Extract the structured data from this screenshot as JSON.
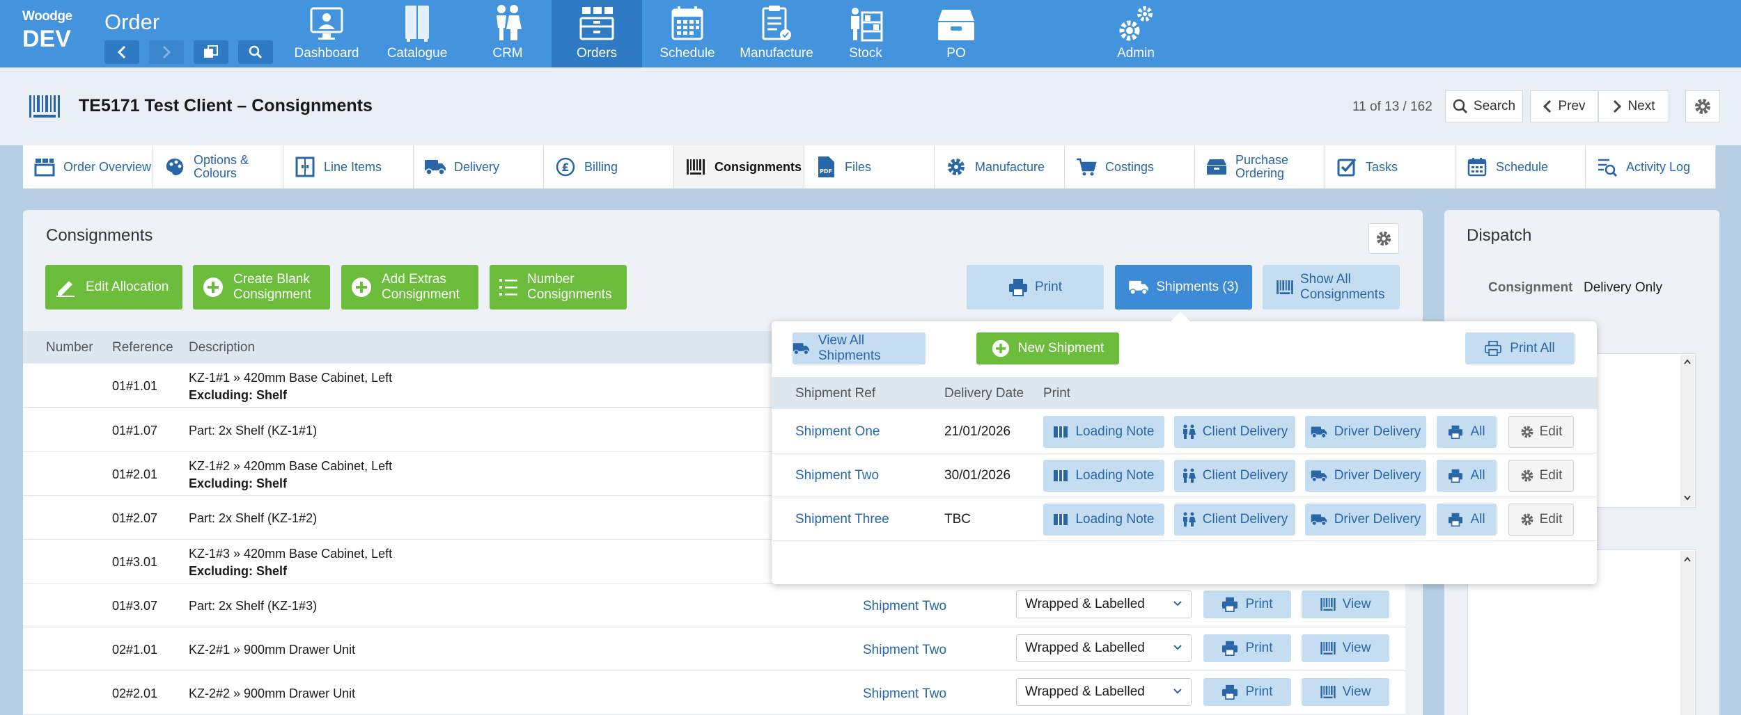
{
  "app": {
    "brand": "Woodge",
    "env": "DEV",
    "module_title": "Order"
  },
  "main_nav": [
    {
      "label": "Dashboard",
      "icon": "dashboard-icon"
    },
    {
      "label": "Catalogue",
      "icon": "catalogue-icon"
    },
    {
      "label": "CRM",
      "icon": "crm-icon"
    },
    {
      "label": "Orders",
      "icon": "orders-icon",
      "active": true
    },
    {
      "label": "Schedule",
      "icon": "schedule-icon"
    },
    {
      "label": "Manufacture",
      "icon": "manufacture-icon"
    },
    {
      "label": "Stock",
      "icon": "stock-icon"
    },
    {
      "label": "PO",
      "icon": "po-icon"
    },
    {
      "label": "Admin",
      "icon": "admin-icon"
    }
  ],
  "header": {
    "title": "TE5171 Test Client – Consignments",
    "counter": "11 of 13 / 162",
    "search_label": "Search",
    "prev_label": "Prev",
    "next_label": "Next"
  },
  "tabs": [
    {
      "label": "Order Overview",
      "icon": "order-overview-icon"
    },
    {
      "label": "Options & Colours",
      "icon": "palette-icon"
    },
    {
      "label": "Line Items",
      "icon": "line-items-icon"
    },
    {
      "label": "Delivery",
      "icon": "truck-icon"
    },
    {
      "label": "Billing",
      "icon": "pound-icon"
    },
    {
      "label": "Consignments",
      "icon": "barcode-icon",
      "active": true
    },
    {
      "label": "Files",
      "icon": "pdf-file-icon"
    },
    {
      "label": "Manufacture",
      "icon": "gear-icon"
    },
    {
      "label": "Costings",
      "icon": "cart-icon"
    },
    {
      "label": "Purchase Ordering",
      "icon": "inbox-icon"
    },
    {
      "label": "Tasks",
      "icon": "checkbox-icon"
    },
    {
      "label": "Schedule",
      "icon": "calendar-icon"
    },
    {
      "label": "Activity Log",
      "icon": "activity-log-icon"
    }
  ],
  "consignments": {
    "title": "Consignments",
    "actions": {
      "edit_allocation": "Edit Allocation",
      "create_blank": "Create Blank Consignment",
      "add_extras": "Add Extras Consignment",
      "number": "Number Consignments",
      "print": "Print",
      "shipments": "Shipments (3)",
      "show_all": "Show All Consignments"
    },
    "columns": {
      "number": "Number",
      "reference": "Reference",
      "description": "Description"
    },
    "rows": [
      {
        "reference": "01#1.01",
        "description": "KZ-1#1 » 420mm Base Cabinet, Left",
        "note": "Excluding: Shelf"
      },
      {
        "reference": "01#1.07",
        "description": "Part: 2x Shelf (KZ-1#1)"
      },
      {
        "reference": "01#2.01",
        "description": "KZ-1#2 » 420mm Base Cabinet, Left",
        "note": "Excluding: Shelf"
      },
      {
        "reference": "01#2.07",
        "description": "Part: 2x Shelf (KZ-1#2)"
      },
      {
        "reference": "01#3.01",
        "description": "KZ-1#3 » 420mm Base Cabinet, Left",
        "note": "Excluding: Shelf"
      },
      {
        "reference": "01#3.07",
        "description": "Part: 2x Shelf (KZ-1#3)",
        "shipment": "Shipment Two",
        "status": "Wrapped & Labelled",
        "print": "Print",
        "view": "View"
      },
      {
        "reference": "02#1.01",
        "description": "KZ-2#1 » 900mm Drawer Unit",
        "shipment": "Shipment Two",
        "status": "Wrapped & Labelled",
        "print": "Print",
        "view": "View"
      },
      {
        "reference": "02#2.01",
        "description": "KZ-2#2 » 900mm Drawer Unit",
        "shipment": "Shipment Two",
        "status": "Wrapped & Labelled",
        "print": "Print",
        "view": "View"
      }
    ]
  },
  "dispatch": {
    "title": "Dispatch",
    "consignment_label": "Consignment",
    "consignment_value": "Delivery Only"
  },
  "shipments_popover": {
    "view_all": "View All Shipments",
    "new_shipment": "New Shipment",
    "print_all": "Print All",
    "columns": {
      "ref": "Shipment Ref",
      "date": "Delivery Date",
      "print": "Print"
    },
    "buttons": {
      "loading_note": "Loading Note",
      "client_delivery": "Client Delivery",
      "driver_delivery": "Driver Delivery",
      "all": "All",
      "edit": "Edit"
    },
    "rows": [
      {
        "ref": "Shipment One",
        "date": "21/01/2026"
      },
      {
        "ref": "Shipment Two",
        "date": "30/01/2026"
      },
      {
        "ref": "Shipment Three",
        "date": "TBC"
      }
    ]
  },
  "colors": {
    "topbar": "#4393dd",
    "active_nav": "#2f7bc3",
    "green": "#6dbd3c",
    "light_blue_button": "#c4ddf1",
    "link": "#2866a8"
  }
}
